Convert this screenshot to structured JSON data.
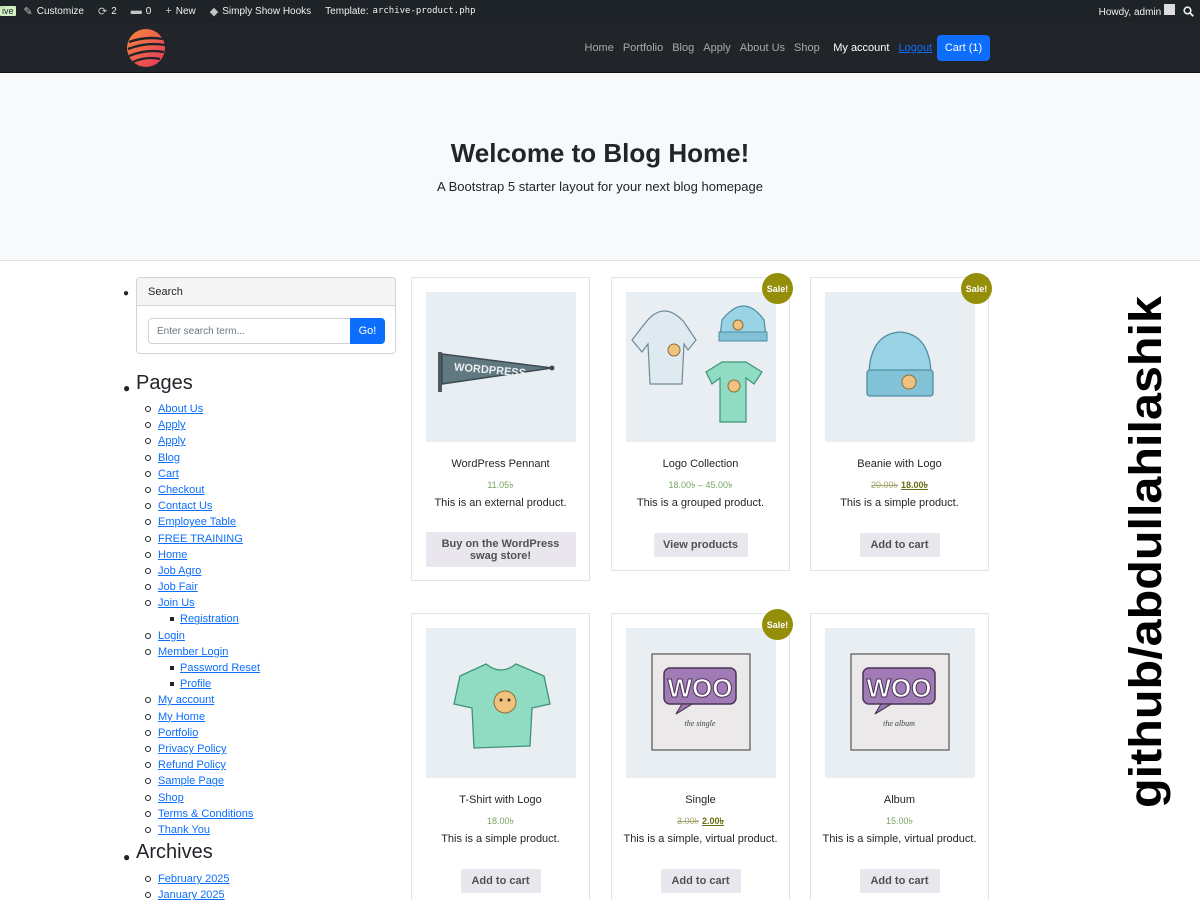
{
  "adminbar": {
    "live": "ive",
    "customize": "Customize",
    "updates": "2",
    "comments": "0",
    "new": "New",
    "hooks": "Simply Show Hooks",
    "template_label": "Template:",
    "template_file": "archive-product.php",
    "howdy": "Howdy, admin"
  },
  "nav": {
    "items": [
      "Home",
      "Portfolio",
      "Blog",
      "Apply",
      "About Us",
      "Shop"
    ],
    "account": "My account",
    "logout": "Logout",
    "cart": "Cart (1)"
  },
  "hero": {
    "title": "Welcome to Blog Home!",
    "subtitle": "A Bootstrap 5 starter layout for your next blog homepage"
  },
  "sidebar": {
    "search_title": "Search",
    "search_placeholder": "Enter search term...",
    "go": "Go!",
    "pages_title": "Pages",
    "pages": [
      {
        "label": "About Us",
        "sub": false
      },
      {
        "label": "Apply",
        "sub": false
      },
      {
        "label": "Apply",
        "sub": false
      },
      {
        "label": "Blog",
        "sub": false
      },
      {
        "label": "Cart",
        "sub": false
      },
      {
        "label": "Checkout",
        "sub": false
      },
      {
        "label": "Contact Us",
        "sub": false
      },
      {
        "label": "Employee Table",
        "sub": false
      },
      {
        "label": "FREE TRAINING",
        "sub": false
      },
      {
        "label": "Home",
        "sub": false
      },
      {
        "label": "Job Agro",
        "sub": false
      },
      {
        "label": "Job Fair",
        "sub": false
      },
      {
        "label": "Join Us",
        "sub": false
      },
      {
        "label": "Registration",
        "sub": true
      },
      {
        "label": "Login",
        "sub": false
      },
      {
        "label": "Member Login",
        "sub": false
      },
      {
        "label": "Password Reset",
        "sub": true
      },
      {
        "label": "Profile",
        "sub": true
      },
      {
        "label": "My account",
        "sub": false
      },
      {
        "label": "My Home",
        "sub": false
      },
      {
        "label": "Portfolio",
        "sub": false
      },
      {
        "label": "Privacy Policy",
        "sub": false
      },
      {
        "label": "Refund Policy",
        "sub": false
      },
      {
        "label": "Sample Page",
        "sub": false
      },
      {
        "label": "Shop",
        "sub": false
      },
      {
        "label": "Terms & Conditions",
        "sub": false
      },
      {
        "label": "Thank You",
        "sub": false
      }
    ],
    "archives_title": "Archives",
    "archives": [
      "February 2025",
      "January 2025"
    ]
  },
  "products": [
    {
      "name": "WordPress Pennant",
      "price": "11.05৳",
      "old_price": "",
      "desc": "This is an external product.",
      "button": "Buy on the WordPress swag store!",
      "sale": false,
      "image": "pennant"
    },
    {
      "name": "Logo Collection",
      "price": "18.00৳ – 45.00৳",
      "old_price": "",
      "desc": "This is a grouped product.",
      "button": "View products",
      "sale": true,
      "image": "collection"
    },
    {
      "name": "Beanie with Logo",
      "price": "18.00৳",
      "old_price": "20.00৳",
      "desc": "This is a simple product.",
      "button": "Add to cart",
      "sale": true,
      "image": "beanie"
    },
    {
      "name": "T-Shirt with Logo",
      "price": "18.00৳",
      "old_price": "",
      "desc": "This is a simple product.",
      "button": "Add to cart",
      "sale": false,
      "image": "tshirt"
    },
    {
      "name": "Single",
      "price": "2.00৳",
      "old_price": "3.00৳",
      "desc": "This is a simple, virtual product.",
      "button": "Add to cart",
      "sale": true,
      "image": "woo-single"
    },
    {
      "name": "Album",
      "price": "15.00৳",
      "old_price": "",
      "desc": "This is a simple, virtual product.",
      "button": "Add to cart",
      "sale": false,
      "image": "woo-album"
    }
  ],
  "sale_label": "Sale!",
  "woo_text": "WOO",
  "woo_single_sub": "the single",
  "woo_album_sub": "the album",
  "pennant_text": "WORDPRESS",
  "watermark": "github/abdullahilashik",
  "colors": {
    "primary": "#0d6efd",
    "navbar": "#212529",
    "adminbar": "#1d2327",
    "sale_badge": "#958e09",
    "price": "#77a464"
  }
}
